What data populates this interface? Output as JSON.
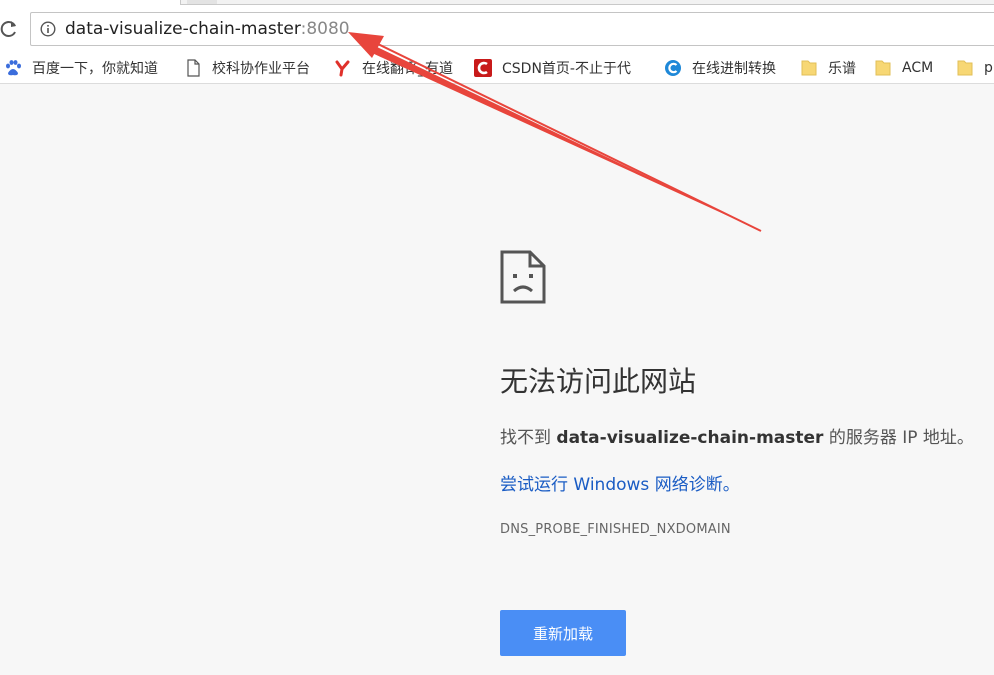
{
  "omnibox": {
    "host": "data-visualize-chain-master",
    "port": ":8080"
  },
  "bookmarks": [
    {
      "label": "百度一下，你就知道",
      "icon": "baidu-paw-icon"
    },
    {
      "label": "校科协作业平台",
      "icon": "page-icon"
    },
    {
      "label": "在线翻译_有道",
      "icon": "youdao-icon"
    },
    {
      "label": "CSDN首页-不止于代",
      "icon": "csdn-icon"
    },
    {
      "label": "在线进制转换",
      "icon": "c-logo-icon"
    },
    {
      "label": "乐谱",
      "icon": "folder-icon"
    },
    {
      "label": "ACM",
      "icon": "folder-icon"
    },
    {
      "label": "p",
      "icon": "folder-icon"
    }
  ],
  "error": {
    "title": "无法访问此网站",
    "desc_prefix": "找不到 ",
    "desc_host": "data-visualize-chain-master",
    "desc_suffix": " 的服务器 IP 地址。",
    "diagnose_link": "尝试运行 Windows 网络诊断。",
    "code": "DNS_PROBE_FINISHED_NXDOMAIN",
    "reload_label": "重新加载"
  },
  "colors": {
    "accent": "#4a8ef5",
    "link": "#1a5cc4",
    "annotation": "#e8453c"
  }
}
